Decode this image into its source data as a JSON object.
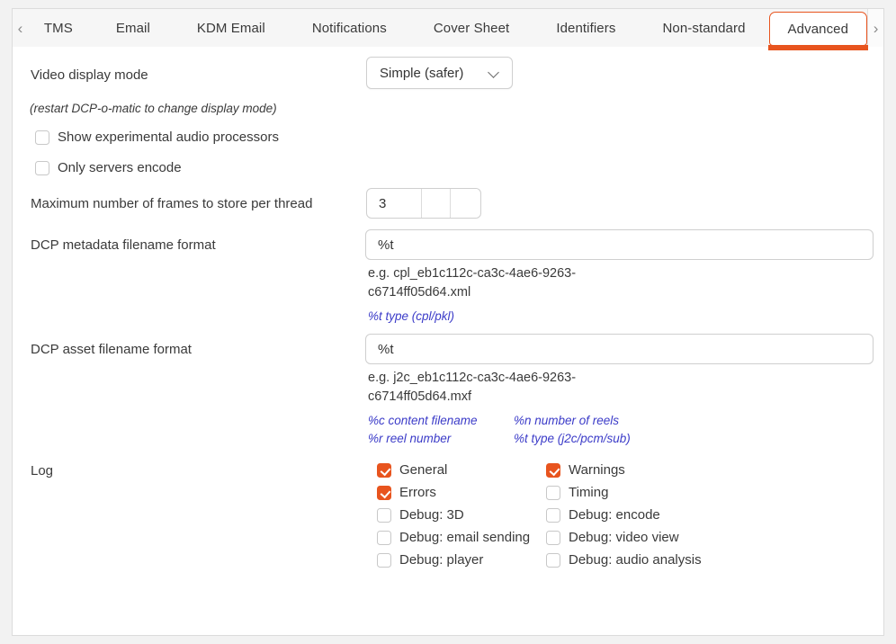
{
  "tabbar": {
    "prev_icon": "chevron-left-icon",
    "next_icon": "chevron-right-icon",
    "prev_glyph": "‹",
    "next_glyph": "›",
    "tabs": [
      {
        "label": "TMS",
        "active": false
      },
      {
        "label": "Email",
        "active": false
      },
      {
        "label": "KDM Email",
        "active": false
      },
      {
        "label": "Notifications",
        "active": false
      },
      {
        "label": "Cover Sheet",
        "active": false
      },
      {
        "label": "Identifiers",
        "active": false
      },
      {
        "label": "Non-standard",
        "active": false
      },
      {
        "label": "Advanced",
        "active": true
      }
    ],
    "active_tab": "Advanced",
    "accent_color": "#e8541e"
  },
  "advanced": {
    "video_display_mode": {
      "label": "Video display mode",
      "value": "Simple (safer)",
      "chevron_icon": "chevron-down-icon"
    },
    "restart_note": "(restart DCP-o-matic to change display mode)",
    "show_experimental_audio_processors": {
      "label": "Show experimental audio processors",
      "checked": false
    },
    "only_servers_encode": {
      "label": "Only servers encode",
      "checked": false
    },
    "max_frames": {
      "label": "Maximum number of frames to store per thread",
      "value": "3"
    },
    "dcp_metadata_filename_format": {
      "label": "DCP metadata filename format",
      "value": "%t",
      "example": "e.g. cpl_eb1c112c-ca3c-4ae6-9263-c6714ff05d64.xml",
      "hints": [
        {
          "col": 0,
          "text": "%t type (cpl/pkl)"
        }
      ]
    },
    "dcp_asset_filename_format": {
      "label": "DCP asset filename format",
      "value": "%t",
      "example": "e.g. j2c_eb1c112c-ca3c-4ae6-9263-c6714ff05d64.mxf",
      "hints": [
        {
          "col": 0,
          "text": "%c content filename"
        },
        {
          "col": 1,
          "text": "%n number of reels"
        },
        {
          "col": 0,
          "text": "%r reel number"
        },
        {
          "col": 1,
          "text": "%t type (j2c/pcm/sub)"
        }
      ]
    },
    "log": {
      "label": "Log",
      "items": [
        {
          "label": "General",
          "checked": true
        },
        {
          "label": "Warnings",
          "checked": true
        },
        {
          "label": "Errors",
          "checked": true
        },
        {
          "label": "Timing",
          "checked": false
        },
        {
          "label": "Debug: 3D",
          "checked": false
        },
        {
          "label": "Debug: encode",
          "checked": false
        },
        {
          "label": "Debug: email sending",
          "checked": false
        },
        {
          "label": "Debug: video view",
          "checked": false
        },
        {
          "label": "Debug: player",
          "checked": false
        },
        {
          "label": "Debug: audio analysis",
          "checked": false
        }
      ]
    }
  }
}
